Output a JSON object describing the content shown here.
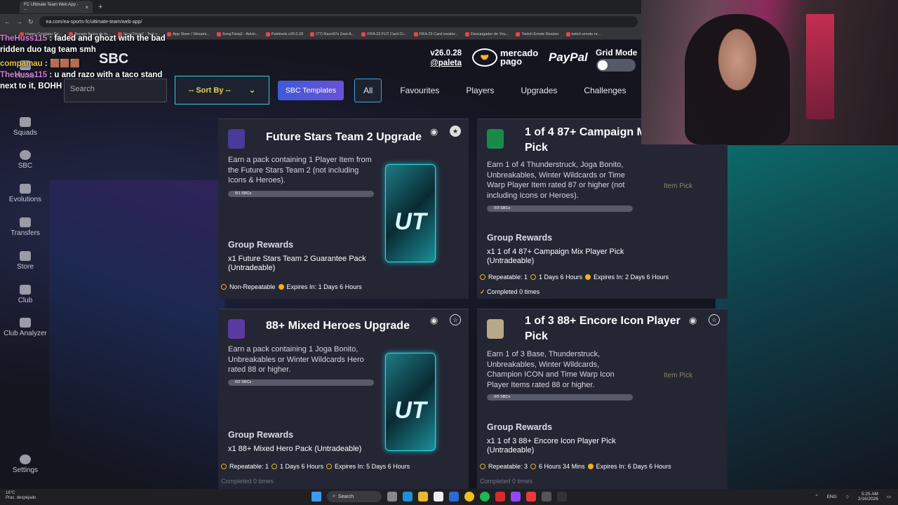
{
  "browser": {
    "tab_title": "FC Ultimate Team Web App - ...",
    "new_tab": "+",
    "url": "ea.com/ea-sports-fc/ultimate-team/web-app/",
    "bookmarks": [
      "Happy Cristiano Ro...",
      "Burago figura de to...",
      "SongTrivia2 - Test y...",
      "App Store / Streami...",
      "SongTrivia2 - Advin...",
      "Paletools v26.0.28",
      "(77) Razo97s Zest-A...",
      "FIFA 23 FUT Card Cr...",
      "FIFA 23 Card creator...",
      "Descargador de You...",
      "Twitch Emote Resizer",
      "twitch emote re..."
    ]
  },
  "header": {
    "page_title": "SBC",
    "search_placeholder": "Search",
    "sort_label": "-- Sort By --",
    "sbc_templates_label": "SBC Templates",
    "filters": [
      "All",
      "Favourites",
      "Players",
      "Upgrades",
      "Challenges"
    ],
    "active_filter": "All",
    "version": "v26.0.28",
    "author": "@paleta",
    "mercado": "mercado",
    "pago": "pago",
    "paypal": "PayPal",
    "grid_mode_label": "Grid Mode"
  },
  "sidebar": {
    "items": [
      {
        "label": "Home",
        "icon": "home-icon"
      },
      {
        "label": "Squads",
        "icon": "squads-icon"
      },
      {
        "label": "SBC",
        "icon": "sbc-icon"
      },
      {
        "label": "Evolutions",
        "icon": "evolutions-icon"
      },
      {
        "label": "Transfers",
        "icon": "transfers-icon"
      },
      {
        "label": "Store",
        "icon": "store-icon"
      },
      {
        "label": "Club",
        "icon": "club-icon"
      },
      {
        "label": "Club Analyzer",
        "icon": "club-analyzer-icon"
      },
      {
        "label": "Settings",
        "icon": "settings-icon"
      }
    ]
  },
  "cards": [
    {
      "title": "Future Stars Team 2 Upgrade",
      "desc": "Earn a pack containing 1 Player Item from the Future Stars Team 2 (not including Icons & Heroes).",
      "progress": "0/1 SBCs",
      "rewards_label": "Group Rewards",
      "reward": "x1 Future Stars Team 2 Guarantee Pack (Untradeable)",
      "repeat": "Non-Repeatable",
      "expires": "Expires In: 1 Days 6 Hours",
      "favourite": true
    },
    {
      "title": "1 of 4 87+ Campaign Mix Player Pick",
      "desc": "Earn 1 of 4 Thunderstruck, Joga Bonito, Unbreakables, Winter Wildcards or Time Warp Player Item rated 87 or higher (not including Icons or Heroes).",
      "progress": "0/3 SBCs",
      "rewards_label": "Group Rewards",
      "reward": "x1 1 of 4 87+ Campaign Mix Player Pick (Untradeable)",
      "repeat": "Repeatable: 1",
      "refresh": "1 Days 6 Hours",
      "expires": "Expires In: 2 Days 6 Hours",
      "completed": "Completed 0 times",
      "item_pick": "Item Pick"
    },
    {
      "title": "88+ Mixed Heroes Upgrade",
      "desc": "Earn a pack containing 1 Joga Bonito, Unbreakables or Winter Wildcards Hero rated 88 or higher.",
      "progress": "0/2 SBCs",
      "rewards_label": "Group Rewards",
      "reward": "x1 88+ Mixed Hero Pack (Untradeable)",
      "repeat": "Repeatable: 1",
      "refresh": "1 Days 6 Hours",
      "expires": "Expires In: 5 Days 6 Hours",
      "completed": "Completed 0 times"
    },
    {
      "title": "1 of 3 88+ Encore Icon Player Pick",
      "desc": "Earn 1 of 3 Base, Thunderstruck, Unbreakables, Winter Wildcards, Champion ICON and Time Warp Icon Player Items rated 88 or higher.",
      "progress": "0/5 SBCs",
      "rewards_label": "Group Rewards",
      "reward": "x1 1 of 3 88+ Encore Icon Player Pick (Untradeable)",
      "repeat": "Repeatable: 3",
      "refresh": "6 Hours 34 Mins",
      "expires": "Expires In: 6 Days 6 Hours",
      "completed": "Completed 0 times",
      "item_pick": "Item Pick"
    }
  ],
  "chat": {
    "line1_name": "TheHuss115",
    "line1_text": ": faded and ghozt with the bad ridden duo tag team smh",
    "line2_name": "compamau",
    "line2_text": ":",
    "line3_name": "TheHuss115",
    "line3_text": ": u and razo with a taco stand next to it, BOHH"
  },
  "taskbar": {
    "weather_temp": "16°C",
    "weather_desc": "Prac. despejado",
    "search": "Search",
    "lang": "ENG",
    "time": "5:25 AM",
    "date": "2/16/2026"
  },
  "colors": {
    "accent": "#40c8d8",
    "gold": "#f0b020",
    "template_btn": "#4f56d8"
  }
}
